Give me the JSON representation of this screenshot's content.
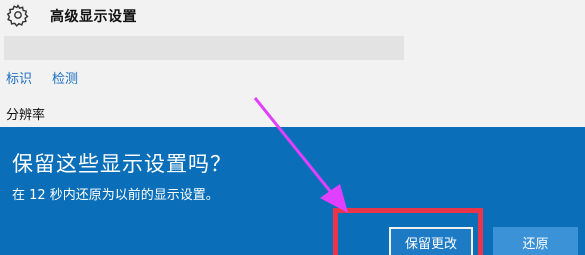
{
  "header": {
    "icon": "gear-icon",
    "title": "高级显示设置"
  },
  "links": {
    "identify": "标识",
    "detect": "检测"
  },
  "section": {
    "resolution_label": "分辨率"
  },
  "dialog": {
    "title": "保留这些显示设置吗？",
    "message": "在 12 秒内还原为以前的显示设置。",
    "keep_button": "保留更改",
    "revert_button": "还原",
    "background_color": "#0a6fb8"
  },
  "annotation": {
    "highlight_color": "#e9344a",
    "arrow_color": "#e040fb"
  }
}
